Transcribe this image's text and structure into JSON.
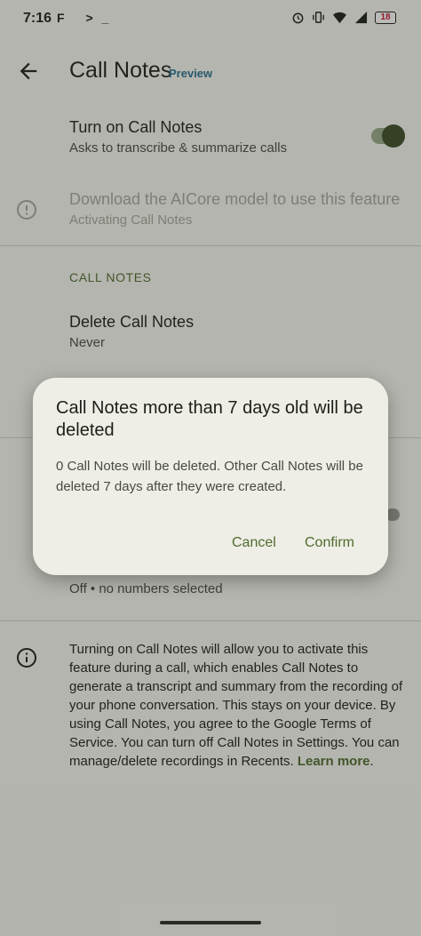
{
  "status_bar": {
    "time": "7:16",
    "app_icons": "F >_",
    "right_icons": [
      "alarm-icon",
      "vibrate-icon",
      "wifi-icon",
      "signal-icon"
    ],
    "battery": "18"
  },
  "app_bar": {
    "title": "Call Notes",
    "badge": "Preview"
  },
  "settings": {
    "turn_on": {
      "title": "Turn on Call Notes",
      "subtitle": "Asks to transcribe & summarize calls",
      "toggle_on": true
    },
    "download": {
      "title": "Download the AICore model to use this feature",
      "subtitle": "Activating Call Notes"
    },
    "section_header": "CALL NOTES",
    "delete": {
      "title": "Delete Call Notes",
      "subtitle": "Never"
    },
    "numbers": {
      "subtitle": "Off • no numbers selected"
    },
    "info": {
      "text": "Turning on Call Notes will allow you to activate this feature during a call, which enables Call Notes to generate a transcript and summary from the recording of your phone conversation. This stays on your device. By using Call Notes, you agree to the Google Terms of Service. You can turn off Call Notes in Settings. You can manage/delete recordings in Recents. ",
      "link": "Learn more",
      "suffix": "."
    }
  },
  "dialog": {
    "title": "Call Notes more than 7 days old will be deleted",
    "body": "0 Call Notes will be deleted. Other Call Notes will be deleted 7 days after they were created.",
    "cancel": "Cancel",
    "confirm": "Confirm"
  },
  "colors": {
    "accent": "#4f6a2e",
    "toggle_thumb": "#3d4b25",
    "preview": "#2a6f8f"
  }
}
